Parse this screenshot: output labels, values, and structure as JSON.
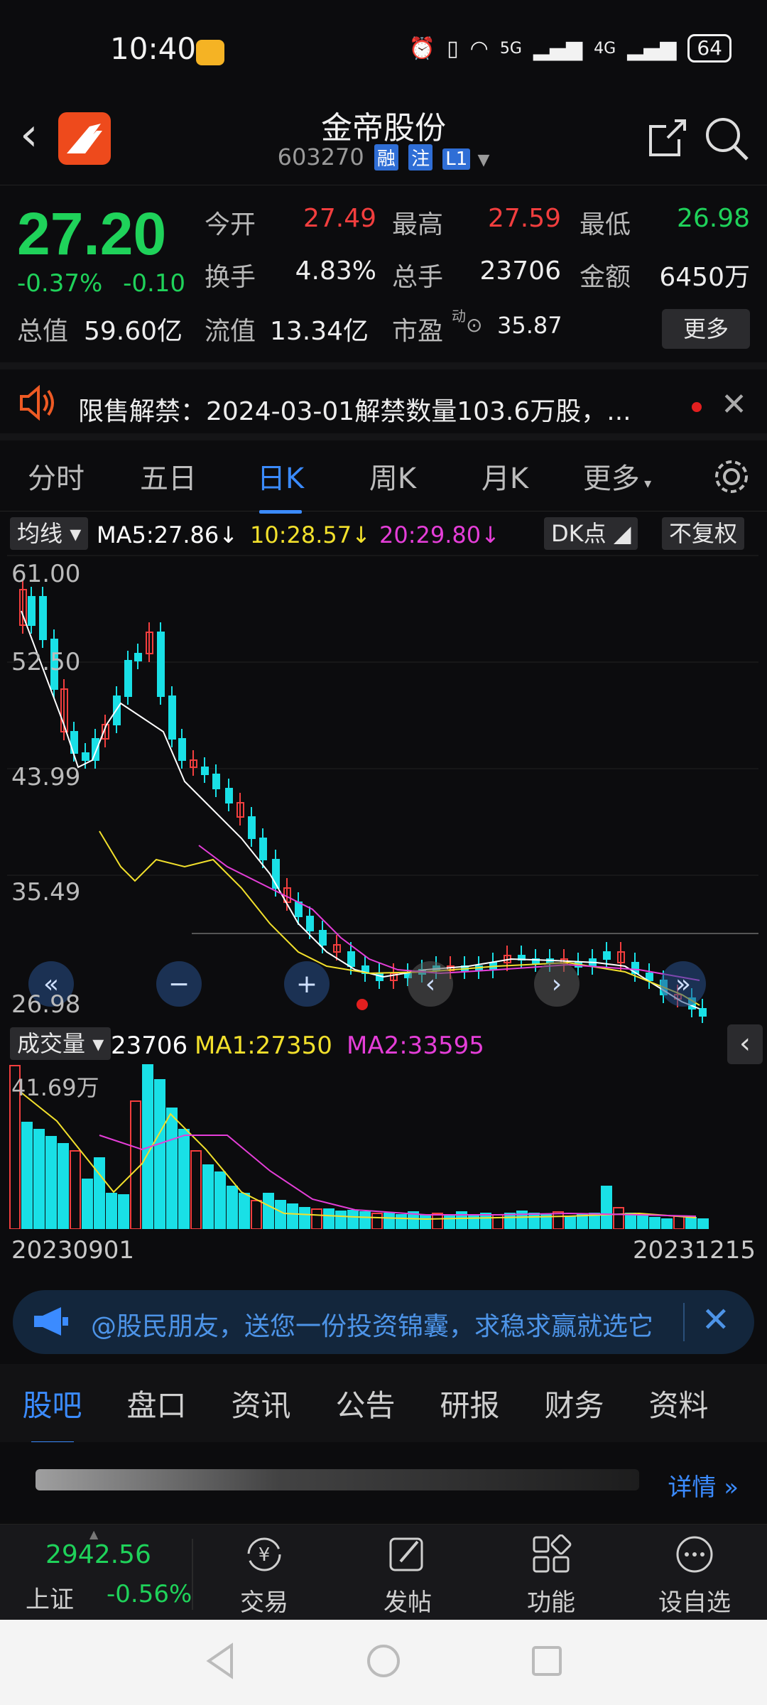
{
  "status": {
    "time": "10:40",
    "net1": "5G",
    "net2": "4G",
    "battery": "64"
  },
  "header": {
    "name": "金帝股份",
    "code": "603270",
    "tags": [
      "融",
      "注",
      "L1"
    ]
  },
  "quote": {
    "price": "27.20",
    "change_pct": "-0.37%",
    "change": "-0.10",
    "open_label": "今开",
    "open": "27.49",
    "high_label": "最高",
    "high": "27.59",
    "low_label": "最低",
    "low": "26.98",
    "turnover_label": "换手",
    "turnover": "4.83%",
    "volume_label": "总手",
    "volume": "23706",
    "amount_label": "金额",
    "amount": "6450万",
    "mcap_label": "总值",
    "mcap": "59.60亿",
    "float_label": "流值",
    "float": "13.34亿",
    "pe_label": "市盈",
    "pe_sup": "动",
    "pe": "35.87",
    "more": "更多"
  },
  "notice": {
    "text": "限售解禁：2024-03-01解禁数量103.6万股，..."
  },
  "tabs": [
    "分时",
    "五日",
    "日K",
    "周K",
    "月K",
    "更多"
  ],
  "indicator": {
    "label": "均线",
    "ma5": "MA5:27.86",
    "ma10": "10:28.57",
    "ma20": "20:29.80",
    "dk": "DK点",
    "adjust": "不复权"
  },
  "kline": {
    "y_ticks": [
      "61.00",
      "52.50",
      "43.99",
      "35.49",
      "26.98"
    ]
  },
  "volume": {
    "label": "成交量",
    "value": "23706",
    "ma1": "MA1:27350",
    "ma2": "MA2:33595",
    "max_label": "41.69万"
  },
  "dates": {
    "start": "20230901",
    "end": "20231215"
  },
  "promo": {
    "text": "@股民朋友，送您一份投资锦囊，求稳求赢就选它"
  },
  "bottom_tabs": [
    "股吧",
    "盘口",
    "资讯",
    "公告",
    "研报",
    "财务",
    "资料"
  ],
  "post": {
    "detail": "详情"
  },
  "index": {
    "value": "2942.56",
    "name": "上证",
    "change": "-0.56%"
  },
  "nav": [
    "交易",
    "发帖",
    "功能",
    "设自选"
  ],
  "colors": {
    "up": "#f23e3e",
    "down": "#1fd25a",
    "accent": "#3b8bff",
    "candle_down": "#19e0e6"
  }
}
